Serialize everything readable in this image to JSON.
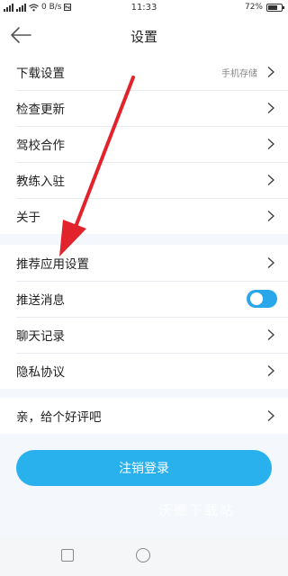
{
  "status_bar": {
    "speed": "0 B/s",
    "time": "11:33",
    "battery": "72%",
    "battery_level": 0.72
  },
  "header": {
    "title": "设置"
  },
  "settings_group_1": [
    {
      "label": "下载设置",
      "value": "手机存储"
    },
    {
      "label": "检查更新"
    },
    {
      "label": "驾校合作"
    },
    {
      "label": "教练入驻"
    },
    {
      "label": "关于"
    }
  ],
  "settings_group_2": [
    {
      "label": "推荐应用设置"
    },
    {
      "label": "推送消息",
      "toggle_on": true
    },
    {
      "label": "聊天记录"
    },
    {
      "label": "隐私协议"
    }
  ],
  "settings_group_3": [
    {
      "label": "亲，给个好评吧"
    }
  ],
  "logout_label": "注销登录",
  "watermark": "沃德下载站",
  "colors": {
    "accent": "#29b1ee",
    "toggle": "#2aa7ea",
    "arrow": "#e3232b",
    "background": "#f4f7fb"
  }
}
